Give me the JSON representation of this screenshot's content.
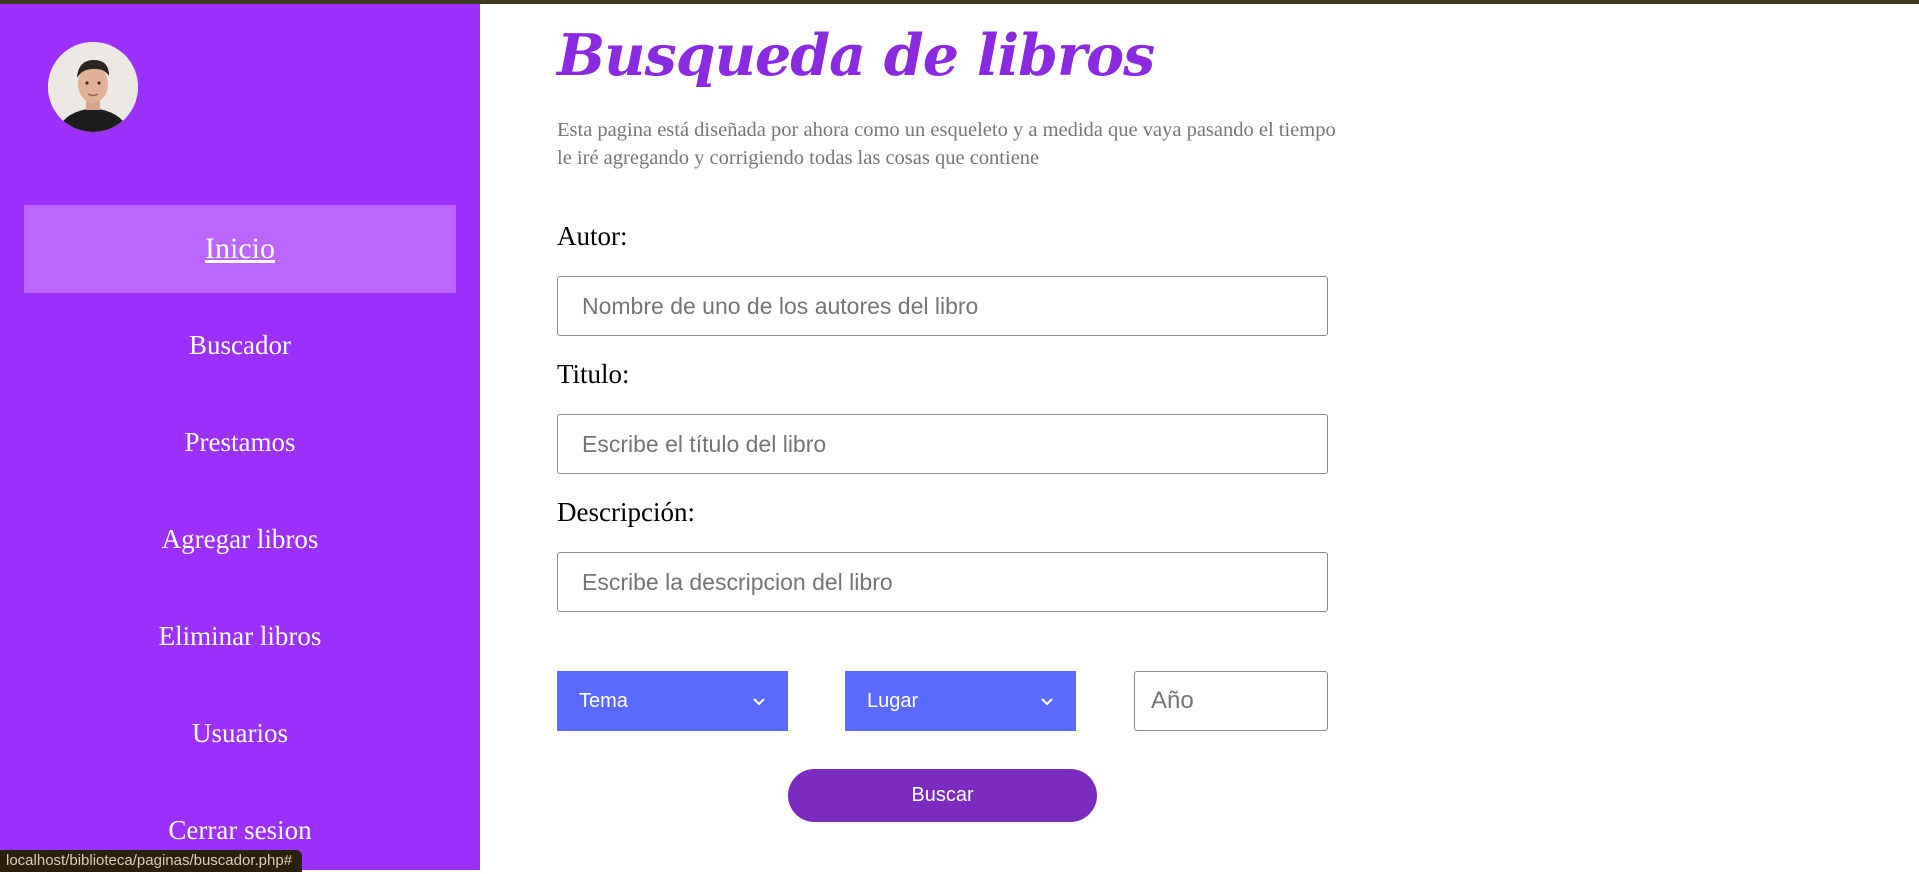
{
  "sidebar": {
    "avatar_alt": "",
    "nav": [
      {
        "label": "Inicio",
        "active": true
      },
      {
        "label": "Buscador"
      },
      {
        "label": "Prestamos"
      },
      {
        "label": "Agregar libros"
      },
      {
        "label": "Eliminar libros"
      },
      {
        "label": "Usuarios"
      },
      {
        "label": "Cerrar sesion"
      }
    ]
  },
  "main": {
    "title": "Busqueda de libros",
    "intro_line1": "Esta pagina está diseñada por ahora como un esqueleto y a medida que vaya pasando el tiempo",
    "intro_line2": "le iré agregando y corrigiendo todas las cosas que contiene",
    "author": {
      "label": "Autor:",
      "placeholder": "Nombre de uno de los autores del libro",
      "value": ""
    },
    "titulo": {
      "label": "Titulo:",
      "placeholder": "Escribe el título del libro",
      "value": ""
    },
    "description": {
      "label": "Descripción:",
      "placeholder": "Escribe la descripcion del libro",
      "value": ""
    },
    "tema_select": {
      "selected": "Tema"
    },
    "lugar_select": {
      "selected": "Lugar"
    },
    "year": {
      "placeholder": "Año",
      "value": ""
    },
    "search_button": "Buscar"
  },
  "status_bar": {
    "url": "localhost/biblioteca/paginas/buscador.php#"
  },
  "colors": {
    "sidebar_bg": "#9b30ff",
    "nav_active_bg": "#bb66ff",
    "title": "#8a2be2",
    "select_bg": "#5b6bff",
    "button_bg": "#7b2cbf",
    "top_border": "#3d3a22"
  }
}
